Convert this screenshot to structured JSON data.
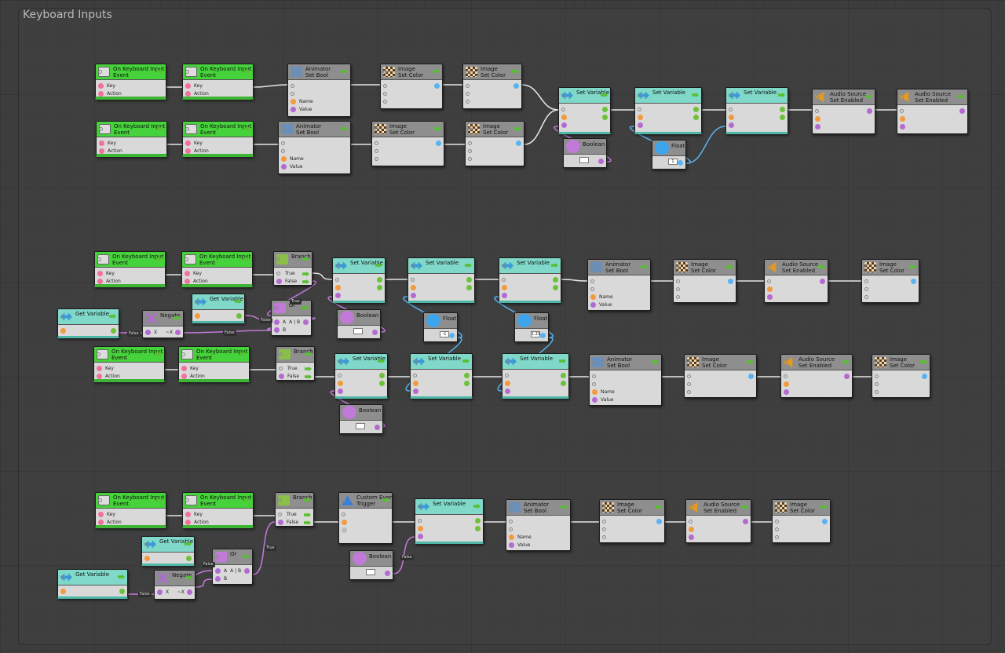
{
  "group": {
    "title": "Keyboard Inputs"
  },
  "labels": {
    "on_keyboard_input": "On Keyboard Input",
    "event": "Event",
    "key": "Key",
    "action": "Action",
    "animator": "Animator",
    "set_bool": "Set Bool",
    "name": "Name",
    "value": "Value",
    "image": "Image",
    "set_color": "Set Color",
    "set_variable": "Set Variable",
    "audio_source": "Audio Source",
    "set_enabled": "Set Enabled",
    "boolean": "Boolean",
    "float": "Float",
    "branch": "Branch",
    "true": "True",
    "false": "False",
    "get_variable": "Get Variable",
    "negate": "Negate",
    "x": "X",
    "not_x": "~X",
    "or": "Or",
    "a": "A",
    "a_or_b": "A | B",
    "b": "B",
    "custom_event": "Custom Event",
    "trigger": "Trigger"
  },
  "literals": {
    "float_1": "1",
    "float_2": "-1",
    "float_3": "1.21",
    "false_tag": "False",
    "true_tag": "True"
  },
  "colors": {
    "event_green": "#46d23a",
    "variable_teal": "#7fd8c8",
    "node_gray": "#8e8e8e",
    "wire": "#e6e6e6",
    "bool_wire": "#c27ad8",
    "float_wire": "#5ab3f0"
  }
}
